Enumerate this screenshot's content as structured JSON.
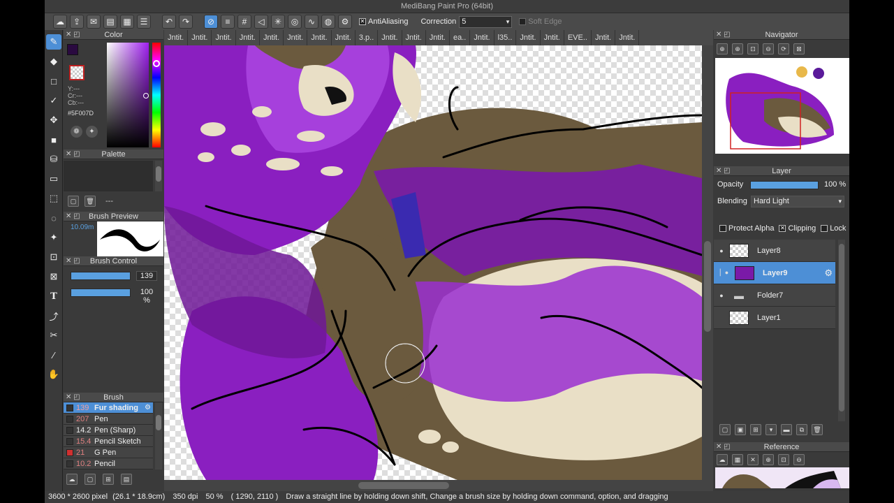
{
  "app": {
    "title": "MediBang Paint Pro (64bit)"
  },
  "toolbar": {
    "antialiasing_label": "AntiAliasing",
    "correction_label": "Correction",
    "correction_value": "5",
    "soft_edge_label": "Soft Edge"
  },
  "tabs": [
    "Jntit.",
    "Jntit.",
    "Jntit.",
    "Jntit.",
    "Jntit.",
    "Jntit.",
    "Jntit.",
    "Jntit.",
    "3.p..",
    "Jntit.",
    "Jntit.",
    "Jntit.",
    "ea..",
    "Jntit.",
    "l35..",
    "Jntit.",
    "Jntit.",
    "EVE..",
    "Jntit.",
    "Jntit."
  ],
  "color_panel": {
    "title": "Color",
    "y_label": "Y:---",
    "cr_label": "Cr:---",
    "cb_label": "Cb:---",
    "hex": "#5F007D",
    "foreground": "#5F007D"
  },
  "palette_panel": {
    "title": "Palette",
    "placeholder": "---"
  },
  "brush_preview_panel": {
    "title": "Brush Preview",
    "size": "10.09m"
  },
  "brush_control_panel": {
    "title": "Brush Control",
    "size_value": "139",
    "opacity_value": "100 %"
  },
  "brush_panel": {
    "title": "Brush",
    "items": [
      {
        "size": "139",
        "name": "Fur shading",
        "color": "#333333"
      },
      {
        "size": "207",
        "name": "Pen",
        "color": "#333333"
      },
      {
        "size": "14.2",
        "name": "Pen (Sharp)",
        "color": "#333333"
      },
      {
        "size": "15.4",
        "name": "Pencil Sketch",
        "color": "#333333"
      },
      {
        "size": "21",
        "name": "G Pen",
        "color": "#d03030"
      },
      {
        "size": "10.2",
        "name": "Pencil",
        "color": "#333333"
      }
    ]
  },
  "navigator_panel": {
    "title": "Navigator"
  },
  "layer_panel": {
    "title": "Layer",
    "opacity_label": "Opacity",
    "opacity_value": "100 %",
    "blending_label": "Blending",
    "blending_value": "Hard Light",
    "protect_alpha_label": "Protect Alpha",
    "clipping_label": "Clipping",
    "lock_label": "Lock",
    "layers": [
      {
        "name": "Layer8"
      },
      {
        "name": "Layer9"
      },
      {
        "name": "Folder7"
      },
      {
        "name": "Layer1"
      }
    ]
  },
  "reference_panel": {
    "title": "Reference"
  },
  "status": {
    "dimensions": "3600 * 2600 pixel",
    "physical": "(26.1 * 18.9cm)",
    "dpi": "350 dpi",
    "zoom": "50 %",
    "cursor": "( 1290, 2110 )",
    "hint": "Draw a straight line by holding down shift, Change a brush size by holding down command, option, and dragging"
  }
}
